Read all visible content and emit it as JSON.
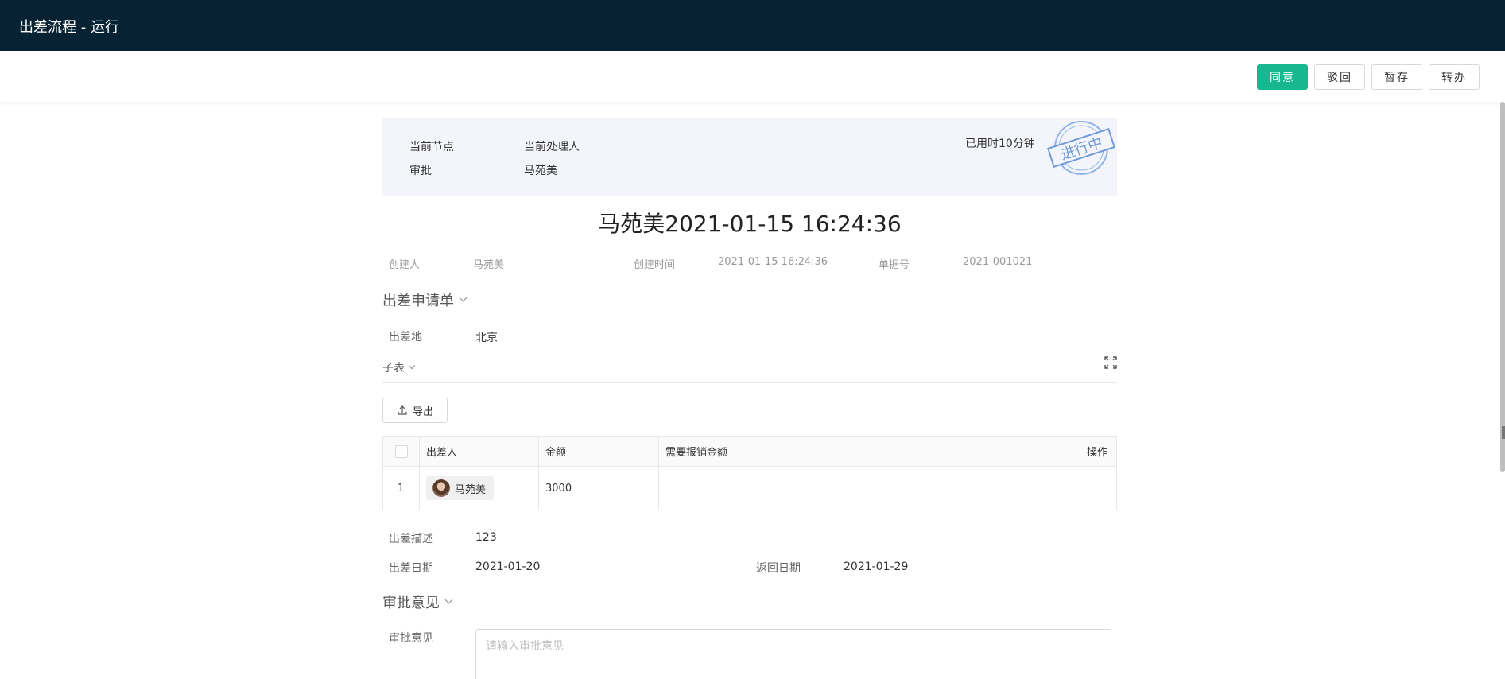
{
  "header": {
    "title": "出差流程 - 运行"
  },
  "toolbar": {
    "agree": "同意",
    "reject": "驳回",
    "save": "暂存",
    "transfer": "转办",
    "accent_color": "#17b890"
  },
  "status": {
    "node_label": "当前节点",
    "node_value": "审批",
    "handler_label": "当前处理人",
    "handler_value": "马苑美",
    "elapsed": "已用时10分钟",
    "stamp_text": "进行中"
  },
  "document": {
    "title": "马苑美2021-01-15 16:24:36",
    "creator_label": "创建人",
    "creator_value": "马苑美",
    "created_label": "创建时间",
    "created_value": "2021-01-15 16:24:36",
    "number_label": "单据号",
    "number_value": "2021-001021"
  },
  "form": {
    "section_title": "出差申请单",
    "destination_label": "出差地",
    "destination_value": "北京",
    "subtable_title": "子表",
    "export_label": "导出",
    "table": {
      "headers": [
        "出差人",
        "金额",
        "需要报销金额",
        "操作"
      ],
      "rows": [
        {
          "index": "1",
          "person": "马苑美",
          "amount": "3000",
          "reimburse": "",
          "action": ""
        }
      ]
    },
    "description_label": "出差描述",
    "description_value": "123",
    "depart_label": "出差日期",
    "depart_value": "2021-01-20",
    "return_label": "返回日期",
    "return_value": "2021-01-29"
  },
  "approval": {
    "section_title": "审批意见",
    "opinion_label": "审批意见",
    "opinion_placeholder": "请输入审批意见"
  }
}
